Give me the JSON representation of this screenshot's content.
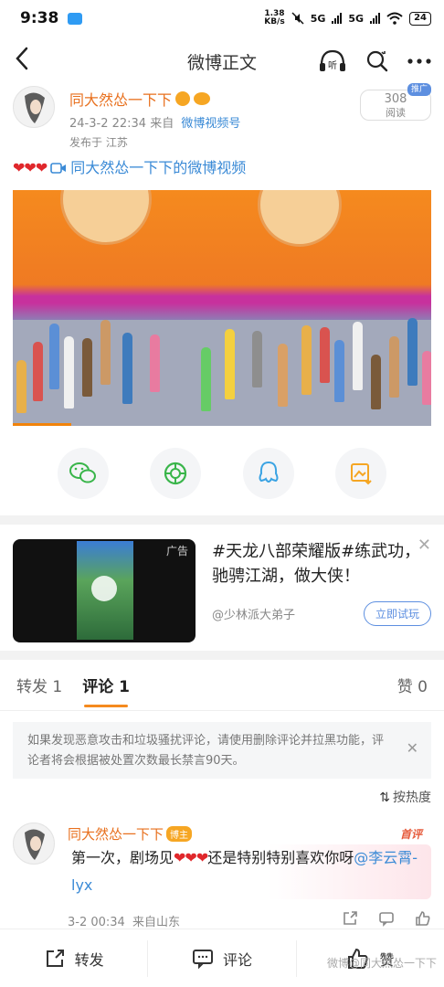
{
  "status": {
    "time": "9:38",
    "speed_top": "1.38",
    "speed_bottom": "KB/s",
    "net1": "5G",
    "net2": "5G",
    "battery": "24"
  },
  "nav": {
    "title": "微博正文"
  },
  "post": {
    "author": "同大然怂一下下",
    "date": "24-3-2 22:34",
    "from_prefix": "来自",
    "source": "微博视频号",
    "location_label": "发布于 江苏",
    "reads_count": "308",
    "reads_label": "阅读",
    "promo_tag": "推广",
    "hearts": "❤❤❤",
    "video_link": "同大然怂一下下的微博视频",
    "video_progress_pct": 14
  },
  "ad": {
    "tag": "广告",
    "text": "#天龙八部荣耀版#练武功，驰骋江湖，做大侠！",
    "sponsor": "@少林派大弟子",
    "cta": "立即试玩"
  },
  "tabs": {
    "repost": "转发 1",
    "comment": "评论 1",
    "like": "赞 0"
  },
  "notice": {
    "text": "如果发现恶意攻击和垃圾骚扰评论，请使用删除评论并拉黑功能，评论者将会根据被处置次数最长禁言90天。"
  },
  "sort": {
    "label": "按热度"
  },
  "comment": {
    "author": "同大然怂一下下",
    "author_tag": "博主",
    "first_tag": "首评",
    "text_before": "第一次，剧场见",
    "hearts": "❤❤❤",
    "text_after": "还是特别特别喜欢你呀",
    "mention": "@李云霄-lyx",
    "time": "3-2 00:34",
    "from": "来自山东"
  },
  "bottom": {
    "repost": "转发",
    "comment": "评论",
    "like": "赞"
  },
  "watermark": "微博@同大然怂一下下",
  "colors": {
    "orange": "#e8701e",
    "link": "#3a8ad6",
    "accent": "#f58a1e"
  }
}
